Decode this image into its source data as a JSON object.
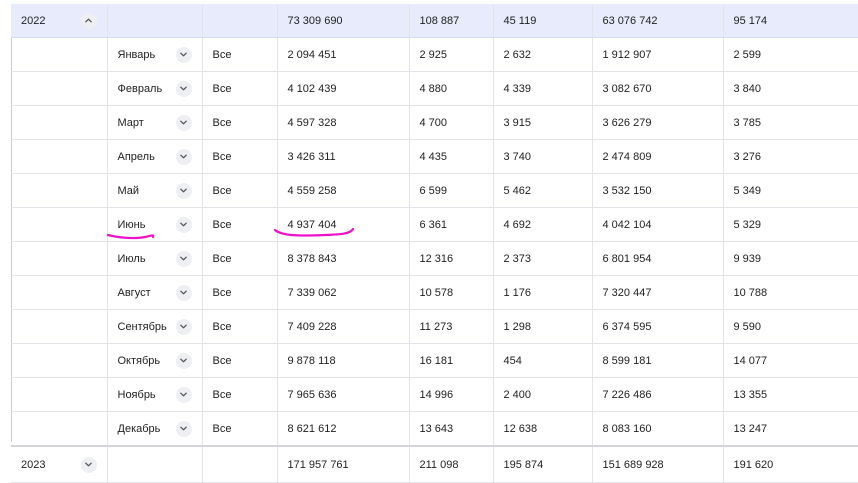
{
  "rows": {
    "y2022": {
      "year": "2022",
      "values": [
        "73 309 690",
        "108 887",
        "45 119",
        "63 076 742",
        "95 174"
      ]
    },
    "months": [
      {
        "name": "Январь",
        "filter": "Все",
        "values": [
          "2 094 451",
          "2 925",
          "2 632",
          "1 912 907",
          "2 599"
        ]
      },
      {
        "name": "Февраль",
        "filter": "Все",
        "values": [
          "4 102 439",
          "4 880",
          "4 339",
          "3 082 670",
          "3 840"
        ]
      },
      {
        "name": "Март",
        "filter": "Все",
        "values": [
          "4 597 328",
          "4 700",
          "3 915",
          "3 626 279",
          "3 785"
        ]
      },
      {
        "name": "Апрель",
        "filter": "Все",
        "values": [
          "3 426 311",
          "4 435",
          "3 740",
          "2 474 809",
          "3 276"
        ]
      },
      {
        "name": "Май",
        "filter": "Все",
        "values": [
          "4 559 258",
          "6 599",
          "5 462",
          "3 532 150",
          "5 349"
        ]
      },
      {
        "name": "Июнь",
        "filter": "Все",
        "values": [
          "4 937 404",
          "6 361",
          "4 692",
          "4 042 104",
          "5 329"
        ]
      },
      {
        "name": "Июль",
        "filter": "Все",
        "values": [
          "8 378 843",
          "12 316",
          "2 373",
          "6 801 954",
          "9 939"
        ]
      },
      {
        "name": "Август",
        "filter": "Все",
        "values": [
          "7 339 062",
          "10 578",
          "1 176",
          "7 320 447",
          "10 788"
        ]
      },
      {
        "name": "Сентябрь",
        "filter": "Все",
        "values": [
          "7 409 228",
          "11 273",
          "1 298",
          "6 374 595",
          "9 590"
        ]
      },
      {
        "name": "Октябрь",
        "filter": "Все",
        "values": [
          "9 878 118",
          "16 181",
          "454",
          "8 599 181",
          "14 077"
        ]
      },
      {
        "name": "Ноябрь",
        "filter": "Все",
        "values": [
          "7 965 636",
          "14 996",
          "2 400",
          "7 226 486",
          "13 355"
        ]
      },
      {
        "name": "Декабрь",
        "filter": "Все",
        "values": [
          "8 621 612",
          "13 643",
          "12 638",
          "8 083 160",
          "13 247"
        ]
      }
    ],
    "y2023": {
      "year": "2023",
      "values": [
        "171 957 761",
        "211 098",
        "195 874",
        "151 689 928",
        "191 620"
      ]
    }
  },
  "icons": {
    "collapse": "chevron-up-icon",
    "expand": "chevron-down-icon"
  },
  "colors": {
    "expanded_year_bg": "#e7ebfb",
    "annotation": "#ee11cc"
  }
}
